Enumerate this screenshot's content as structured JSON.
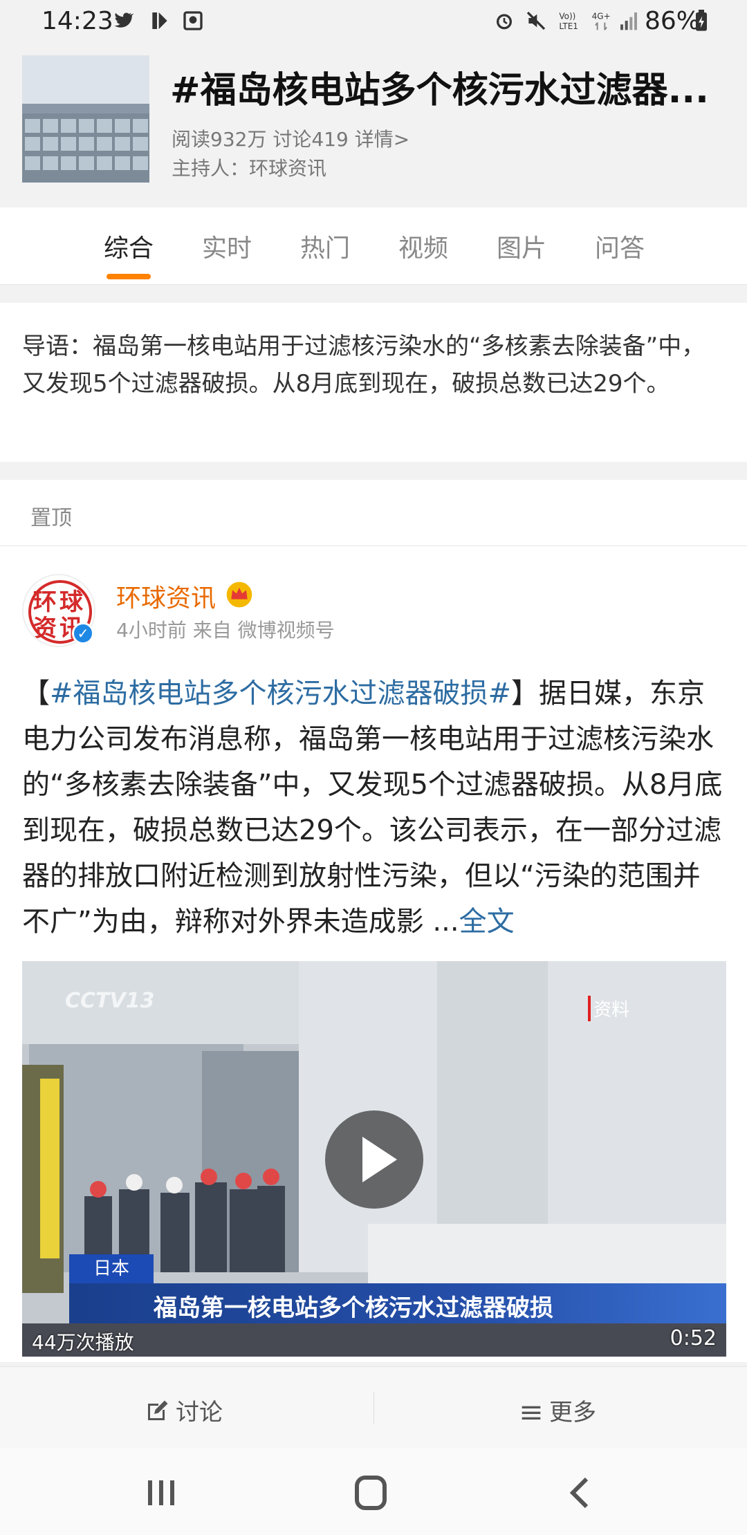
{
  "status_bar": {
    "time": "14:23",
    "battery": "86%"
  },
  "topic": {
    "title": "#福岛核电站多个核污水过滤器...",
    "stats": "阅读932万 讨论419 详情>",
    "host": "主持人：环球资讯"
  },
  "tabs": [
    "综合",
    "实时",
    "热门",
    "视频",
    "图片",
    "问答"
  ],
  "intro": {
    "text": "导语：福岛第一核电站用于过滤核污染水的“多核素去除装备”中，又发现5个过滤器破损。从8月底到现在，破损总数已达29个。"
  },
  "pinned": {
    "label": "置顶"
  },
  "post": {
    "author": "环球资讯",
    "meta": "4小时前 来自 微博视频号",
    "open_bracket": "【",
    "hashtag": "#福岛核电站多个核污水过滤器破损#",
    "body": "】据日媒，东京电力公司发布消息称，福岛第一核电站用于过滤核污染水的“多核素去除装备”中，又发现5个过滤器破损。从8月底到现在，破损总数已达29个。该公司表示，在一部分过滤器的排放口附近检测到放射性污染，但以“污染的范围并不广”为由，辩称对外界未造成影 ...",
    "more_link": "全文",
    "video": {
      "view_count": "44万次播放",
      "duration": "0:52",
      "country_tag": "日本",
      "headline": "福岛第一核电站多个核污水过滤器破损",
      "watermark": "CCTV13",
      "source_tag": "资料"
    }
  },
  "actions": {
    "discuss": "讨论",
    "more": "更多"
  },
  "colors": {
    "accent": "#ff8200",
    "link": "#2d6ca2",
    "author": "#e86a00"
  }
}
